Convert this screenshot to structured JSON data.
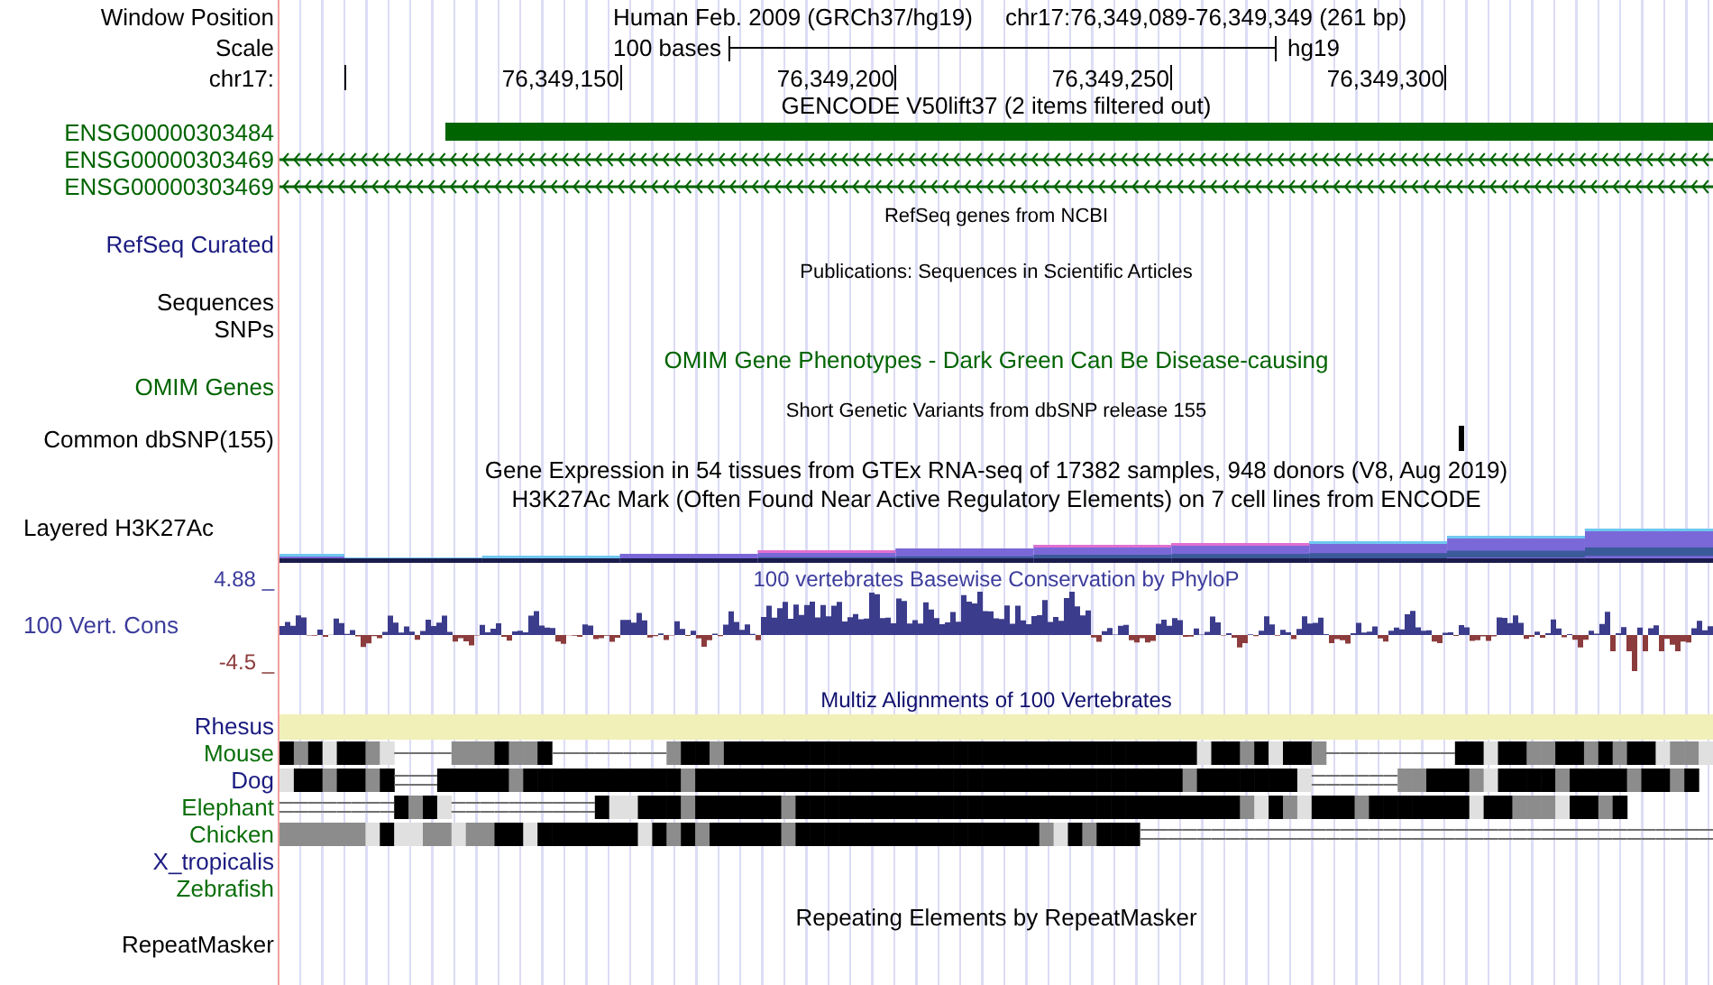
{
  "header": {
    "label": "Window Position",
    "assembly": "Human Feb. 2009 (GRCh37/hg19)",
    "position": "chr17:76,349,089-76,349,349 (261 bp)"
  },
  "scale": {
    "label": "Scale",
    "length": "100 bases",
    "assembly": "hg19"
  },
  "ruler": {
    "label": "chr17:",
    "ticks": [
      "76,349,150",
      "76,349,200",
      "76,349,250",
      "76,349,300"
    ]
  },
  "gencode": {
    "title": "GENCODE V50lift37 (2 items filtered out)",
    "items": [
      {
        "label": "ENSG00000303484",
        "kind": "block"
      },
      {
        "label": "ENSG00000303469",
        "kind": "strand"
      },
      {
        "label": "ENSG00000303469",
        "kind": "strand"
      }
    ]
  },
  "refseq": {
    "title": "RefSeq genes from NCBI",
    "label": "RefSeq Curated"
  },
  "publications": {
    "title": "Publications: Sequences in Scientific Articles",
    "labels": [
      "Sequences",
      "SNPs"
    ]
  },
  "omim": {
    "title": "OMIM Gene Phenotypes - Dark Green Can Be Disease-causing",
    "label": "OMIM Genes"
  },
  "dbsnp": {
    "title": "Short Genetic Variants from dbSNP release 155",
    "label": "Common dbSNP(155)"
  },
  "gtex": {
    "title": "Gene Expression in 54 tissues from GTEx RNA-seq of 17382 samples, 948 donors (V8, Aug 2019)"
  },
  "h3k27ac": {
    "title": "H3K27Ac Mark (Often Found Near Active Regulatory Elements) on 7 cell lines from ENCODE",
    "label": "Layered H3K27Ac"
  },
  "conservation": {
    "title": "100 vertebrates Basewise Conservation by PhyloP",
    "label": "100 Vert. Cons",
    "max": "4.88 _",
    "min": "-4.5 _"
  },
  "multiz": {
    "title": "Multiz Alignments of 100 Vertebrates",
    "species": [
      {
        "label": "Rhesus",
        "color": "#1a1a80",
        "kind": "bar"
      },
      {
        "label": "Mouse",
        "color": "#0a6e0a",
        "kind": "blocks"
      },
      {
        "label": "Dog",
        "color": "#1a1a80",
        "kind": "blocks"
      },
      {
        "label": "Elephant",
        "color": "#0a6e0a",
        "kind": "blocks"
      },
      {
        "label": "Chicken",
        "color": "#0a6e0a",
        "kind": "blocks"
      },
      {
        "label": "X_tropicalis",
        "color": "#1a1a80",
        "kind": "empty"
      },
      {
        "label": "Zebrafish",
        "color": "#0a6e0a",
        "kind": "empty"
      }
    ]
  },
  "repeatmasker": {
    "title": "Repeating Elements by RepeatMasker",
    "label": "RepeatMasker"
  }
}
